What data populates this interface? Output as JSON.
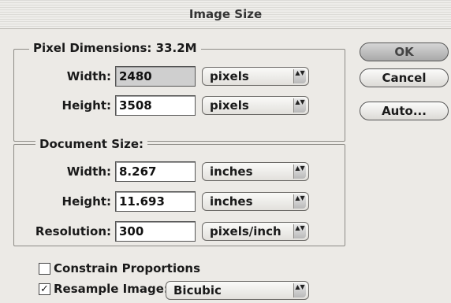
{
  "dialog": {
    "title": "Image Size"
  },
  "pixel_dimensions": {
    "heading": "Pixel Dimensions:",
    "size": "33.2M",
    "width": {
      "label": "Width:",
      "value": "2480",
      "unit": "pixels"
    },
    "height": {
      "label": "Height:",
      "value": "3508",
      "unit": "pixels"
    }
  },
  "document_size": {
    "heading": "Document Size:",
    "width": {
      "label": "Width:",
      "value": "8.267",
      "unit": "inches"
    },
    "height": {
      "label": "Height:",
      "value": "11.693",
      "unit": "inches"
    },
    "resolution": {
      "label": "Resolution:",
      "value": "300",
      "unit": "pixels/inch"
    }
  },
  "buttons": {
    "ok": "OK",
    "cancel": "Cancel",
    "auto": "Auto..."
  },
  "options": {
    "constrain": {
      "label": "Constrain Proportions",
      "checked": false
    },
    "resample": {
      "label": "Resample Image:",
      "checked": true,
      "method": "Bicubic"
    }
  },
  "icons": {
    "checkmark": "✓",
    "stepper": "▲▼"
  }
}
